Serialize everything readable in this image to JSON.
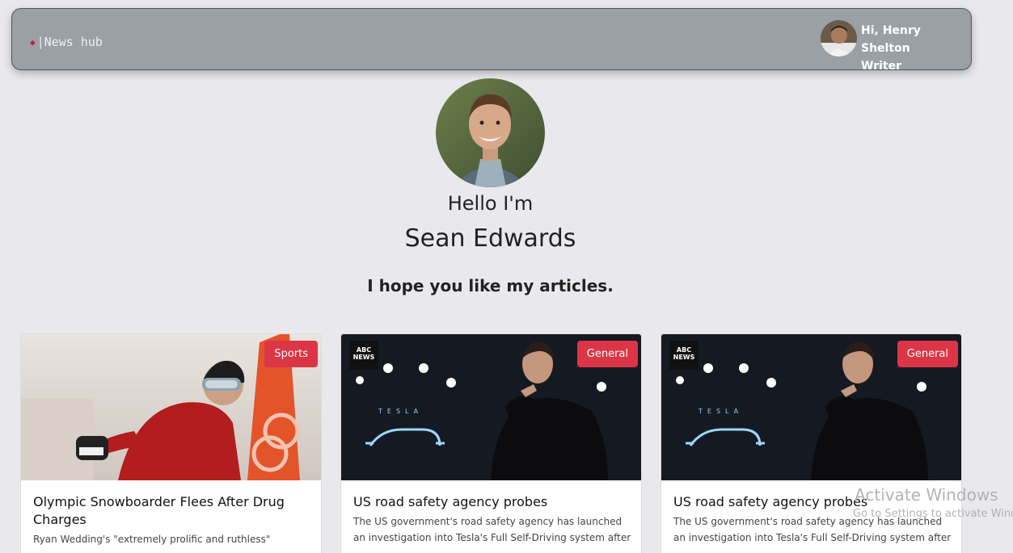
{
  "navbar": {
    "brand": "News hub",
    "user_greeting": "Hi, Henry Shelton",
    "user_role": "Writer"
  },
  "profile": {
    "hello": "Hello I'm",
    "name": "Sean Edwards",
    "tagline": "I hope you like my articles."
  },
  "articles": [
    {
      "category": "Sports",
      "title": "Olympic Snowboarder Flees After Drug Charges",
      "description": "Ryan Wedding's \"extremely prolific and ruthless\""
    },
    {
      "category": "General",
      "title": "US road safety agency probes",
      "description": "The US government's road safety agency has launched an investigation into Tesla's Full Self-Driving system after"
    },
    {
      "category": "General",
      "title": "US road safety agency probes",
      "description": "The US government's road safety agency has launched an investigation into Tesla's Full Self-Driving system after"
    }
  ],
  "image_logo_text": "ABC NEWS",
  "image_brand_text": "TESLA",
  "watermark": {
    "title": "Activate Windows",
    "subtitle": "Go to Settings to activate Windows."
  },
  "colors": {
    "navbar_bg": "#9aa0a6",
    "badge": "#dc3545",
    "brand_icon": "#b5223a"
  }
}
